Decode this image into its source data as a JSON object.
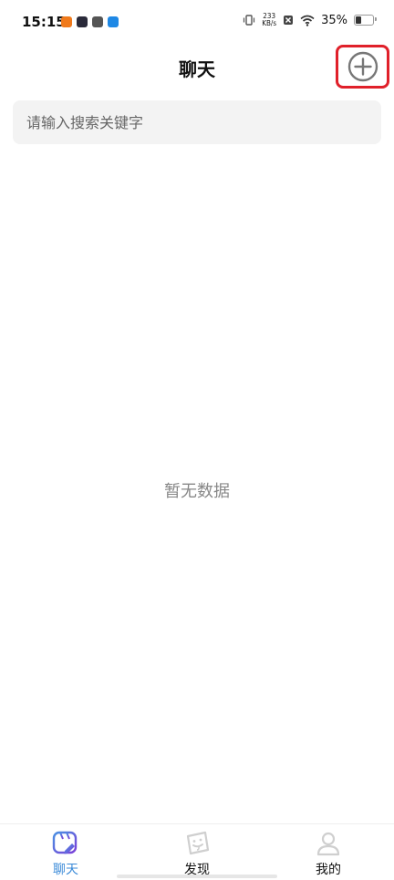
{
  "status_bar": {
    "time": "15:15",
    "net_speed_value": "233",
    "net_speed_unit": "KB/s",
    "battery_percent": "35%",
    "battery_level": 0.35
  },
  "header": {
    "title": "聊天"
  },
  "search": {
    "placeholder": "请输入搜索关键字"
  },
  "main": {
    "empty_text": "暂无数据"
  },
  "bottom_nav": {
    "items": [
      {
        "label": "聊天",
        "icon": "chat-icon",
        "active": true
      },
      {
        "label": "发现",
        "icon": "discover-icon",
        "active": false
      },
      {
        "label": "我的",
        "icon": "profile-icon",
        "active": false
      }
    ]
  },
  "colors": {
    "accent": "#3a8ad8",
    "highlight_box": "#e0202a",
    "search_bg": "#f3f3f3"
  }
}
